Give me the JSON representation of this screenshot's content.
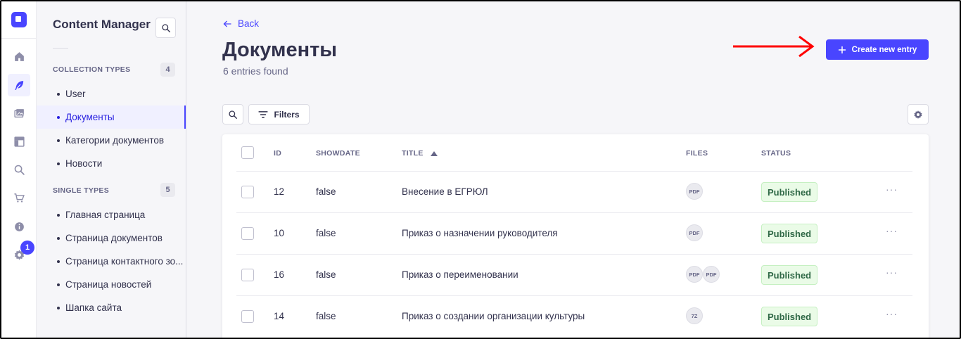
{
  "rail": {
    "items": [
      {
        "name": "home-icon"
      },
      {
        "name": "feather-icon"
      },
      {
        "name": "media-icon"
      },
      {
        "name": "layout-icon"
      },
      {
        "name": "search-icon"
      },
      {
        "name": "cart-icon"
      },
      {
        "name": "info-icon"
      },
      {
        "name": "gear-icon"
      }
    ],
    "settings_badge": "1"
  },
  "sidebar": {
    "title": "Content Manager",
    "collection_types": {
      "label": "COLLECTION TYPES",
      "count": "4",
      "items": [
        "User",
        "Документы",
        "Категории документов",
        "Новости"
      ],
      "active_index": 1
    },
    "single_types": {
      "label": "SINGLE TYPES",
      "count": "5",
      "items": [
        "Главная страница",
        "Страница документов",
        "Страница контактного зо...",
        "Страница новостей",
        "Шапка сайта"
      ]
    }
  },
  "header": {
    "back_label": "Back",
    "title": "Документы",
    "subtitle": "6 entries found",
    "create_label": "Create new entry"
  },
  "toolbar": {
    "filters_label": "Filters"
  },
  "table": {
    "columns": {
      "id": "ID",
      "showdate": "SHOWDATE",
      "title": "TITLE",
      "files": "FILES",
      "status": "STATUS"
    },
    "rows": [
      {
        "id": "12",
        "showdate": "false",
        "title": "Внесение в ЕГРЮЛ",
        "files": [
          "PDF"
        ],
        "status": "Published"
      },
      {
        "id": "10",
        "showdate": "false",
        "title": "Приказ о назначении руководителя",
        "files": [
          "PDF"
        ],
        "status": "Published"
      },
      {
        "id": "16",
        "showdate": "false",
        "title": "Приказ о переименовании",
        "files": [
          "PDF",
          "PDF"
        ],
        "status": "Published"
      },
      {
        "id": "14",
        "showdate": "false",
        "title": "Приказ о создании организации культуры",
        "files": [
          "7Z"
        ],
        "status": "Published"
      }
    ]
  },
  "colors": {
    "accent": "#4945ff",
    "published_bg": "#eafbe7",
    "published_text": "#2f6846",
    "annotation_arrow": "#ff0000"
  }
}
